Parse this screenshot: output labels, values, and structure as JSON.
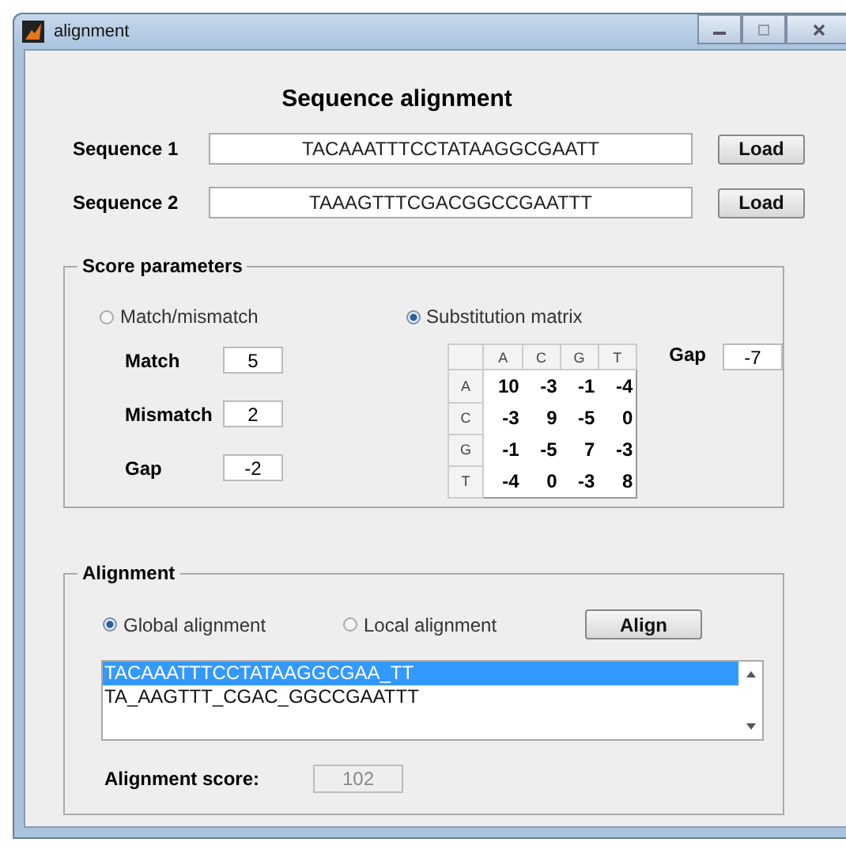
{
  "window": {
    "title": "alignment"
  },
  "heading": "Sequence alignment",
  "sequences": [
    {
      "label": "Sequence 1",
      "value": "TACAAATTTCCTATAAGGCGAATT",
      "button": "Load"
    },
    {
      "label": "Sequence 2",
      "value": "TAAAGTTTCGACGGCCGAATTT",
      "button": "Load"
    }
  ],
  "score_parameters": {
    "title": "Score parameters",
    "modes": [
      {
        "label": "Match/mismatch",
        "selected": false
      },
      {
        "label": "Substitution matrix",
        "selected": true
      }
    ],
    "fields": [
      {
        "label": "Match",
        "value": "5"
      },
      {
        "label": "Mismatch",
        "value": "2"
      },
      {
        "label": "Gap",
        "value": "-2"
      }
    ],
    "matrix": {
      "columns": [
        "A",
        "C",
        "G",
        "T"
      ],
      "rows": [
        {
          "header": "A",
          "values": [
            "10",
            "-3",
            "-1",
            "-4"
          ]
        },
        {
          "header": "C",
          "values": [
            "-3",
            "9",
            "-5",
            "0"
          ]
        },
        {
          "header": "G",
          "values": [
            "-1",
            "-5",
            "7",
            "-3"
          ]
        },
        {
          "header": "T",
          "values": [
            "-4",
            "0",
            "-3",
            "8"
          ]
        }
      ]
    },
    "matrix_gap": {
      "label": "Gap",
      "value": "-7"
    }
  },
  "alignment": {
    "title": "Alignment",
    "modes": [
      {
        "label": "Global alignment",
        "selected": true
      },
      {
        "label": "Local alignment",
        "selected": false
      }
    ],
    "button": "Align",
    "lines": [
      {
        "text": "TACAAATTTCCTATAAGGCGAA_TT",
        "selected": true
      },
      {
        "text": "TA_AAGTTT_CGAC_GGCCGAATTT",
        "selected": false
      }
    ],
    "score": {
      "label": "Alignment score:",
      "value": "102",
      "disabled": true
    }
  }
}
